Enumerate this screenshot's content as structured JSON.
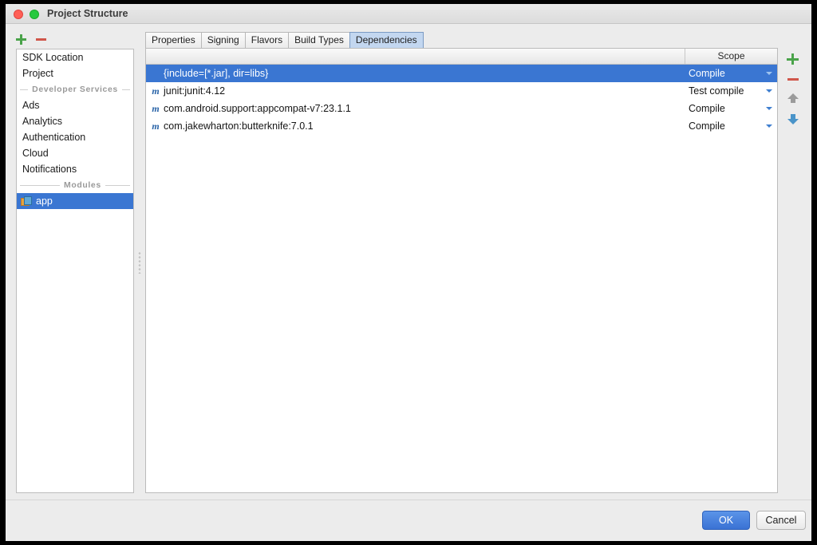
{
  "window": {
    "title": "Project Structure",
    "controls": {
      "close": "close-button",
      "zoom": "zoom-button"
    }
  },
  "left_toolbar": {
    "add_label": "+",
    "remove_label": "−"
  },
  "sidebar": {
    "items": [
      {
        "type": "item",
        "label": "SDK Location",
        "selected": false,
        "icon": null
      },
      {
        "type": "item",
        "label": "Project",
        "selected": false,
        "icon": null
      },
      {
        "type": "separator",
        "label": "Developer Services"
      },
      {
        "type": "item",
        "label": "Ads",
        "selected": false,
        "icon": null
      },
      {
        "type": "item",
        "label": "Analytics",
        "selected": false,
        "icon": null
      },
      {
        "type": "item",
        "label": "Authentication",
        "selected": false,
        "icon": null
      },
      {
        "type": "item",
        "label": "Cloud",
        "selected": false,
        "icon": null
      },
      {
        "type": "item",
        "label": "Notifications",
        "selected": false,
        "icon": null
      },
      {
        "type": "separator",
        "label": "Modules"
      },
      {
        "type": "item",
        "label": "app",
        "selected": true,
        "icon": "module-icon"
      }
    ]
  },
  "tabs": [
    {
      "label": "Properties",
      "active": false
    },
    {
      "label": "Signing",
      "active": false
    },
    {
      "label": "Flavors",
      "active": false
    },
    {
      "label": "Build Types",
      "active": false
    },
    {
      "label": "Dependencies",
      "active": true
    }
  ],
  "table": {
    "headers": {
      "name": "",
      "scope": "Scope"
    },
    "rows": [
      {
        "icon": null,
        "name": "{include=[*.jar], dir=libs}",
        "scope": "Compile",
        "selected": true
      },
      {
        "icon": "maven-icon",
        "name": "junit:junit:4.12",
        "scope": "Test compile",
        "selected": false
      },
      {
        "icon": "maven-icon",
        "name": "com.android.support:appcompat-v7:23.1.1",
        "scope": "Compile",
        "selected": false
      },
      {
        "icon": "maven-icon",
        "name": "com.jakewharton:butterknife:7.0.1",
        "scope": "Compile",
        "selected": false
      }
    ]
  },
  "side_toolbar": {
    "add": "add-dependency-button",
    "remove": "remove-dependency-button",
    "move_up": "move-up-button",
    "move_down": "move-down-button"
  },
  "footer": {
    "ok_label": "OK",
    "cancel_label": "Cancel"
  },
  "colors": {
    "selection_blue": "#3a76d2",
    "active_tab": "#c3d7f0",
    "accent_green": "#4aa34a",
    "accent_red": "#d0564a",
    "ok_button": "#3a72d4"
  }
}
